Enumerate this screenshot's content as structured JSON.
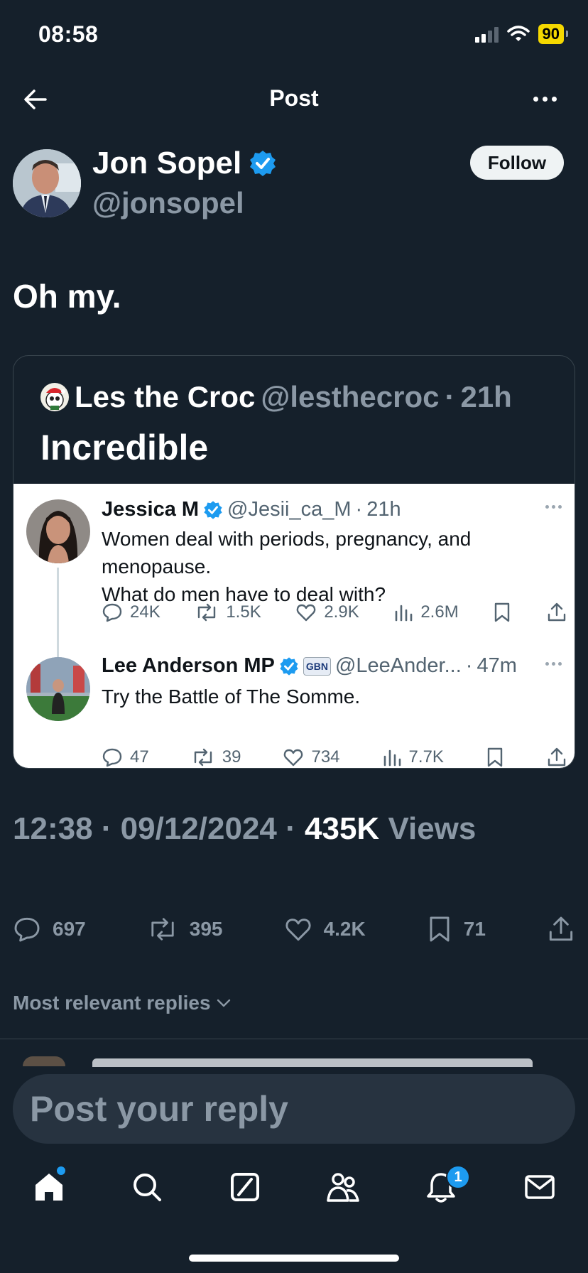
{
  "status_bar": {
    "time": "08:58",
    "battery": "90"
  },
  "header": {
    "title": "Post"
  },
  "author": {
    "name": "Jon Sopel",
    "handle": "@jonsopel",
    "follow_label": "Follow"
  },
  "post": {
    "text": "Oh my."
  },
  "quote": {
    "author_name": "Les the Croc",
    "handle": "@lesthecroc",
    "time": "21h",
    "text": "Incredible",
    "screenshot": {
      "tweet1": {
        "name": "Jessica M",
        "handle": "@Jesii_ca_M",
        "time": "21h",
        "lines": [
          "Women deal with periods, pregnancy, and",
          "menopause.",
          "What do men have to deal with?"
        ],
        "replies": "24K",
        "reposts": "1.5K",
        "likes": "2.9K",
        "views": "2.6M"
      },
      "tweet2": {
        "name": "Lee Anderson MP",
        "handle": "@LeeAnder...",
        "time": "47m",
        "affiliate": "GBN",
        "text": "Try the Battle of The Somme.",
        "replies": "47",
        "reposts": "39",
        "likes": "734",
        "views": "7.7K"
      }
    }
  },
  "meta": {
    "time": "12:38",
    "date": "09/12/2024",
    "views_count": "435K",
    "views_label": "Views"
  },
  "metrics": {
    "replies": "697",
    "reposts": "395",
    "likes": "4.2K",
    "bookmarks": "71"
  },
  "replies_sort": {
    "label": "Most relevant replies"
  },
  "reply_input": {
    "placeholder": "Post your reply"
  },
  "tab_bar": {
    "notifications_badge": "1"
  },
  "colors": {
    "background": "#15202b",
    "accent": "#1d9bf0",
    "battery": "#f5d800"
  }
}
